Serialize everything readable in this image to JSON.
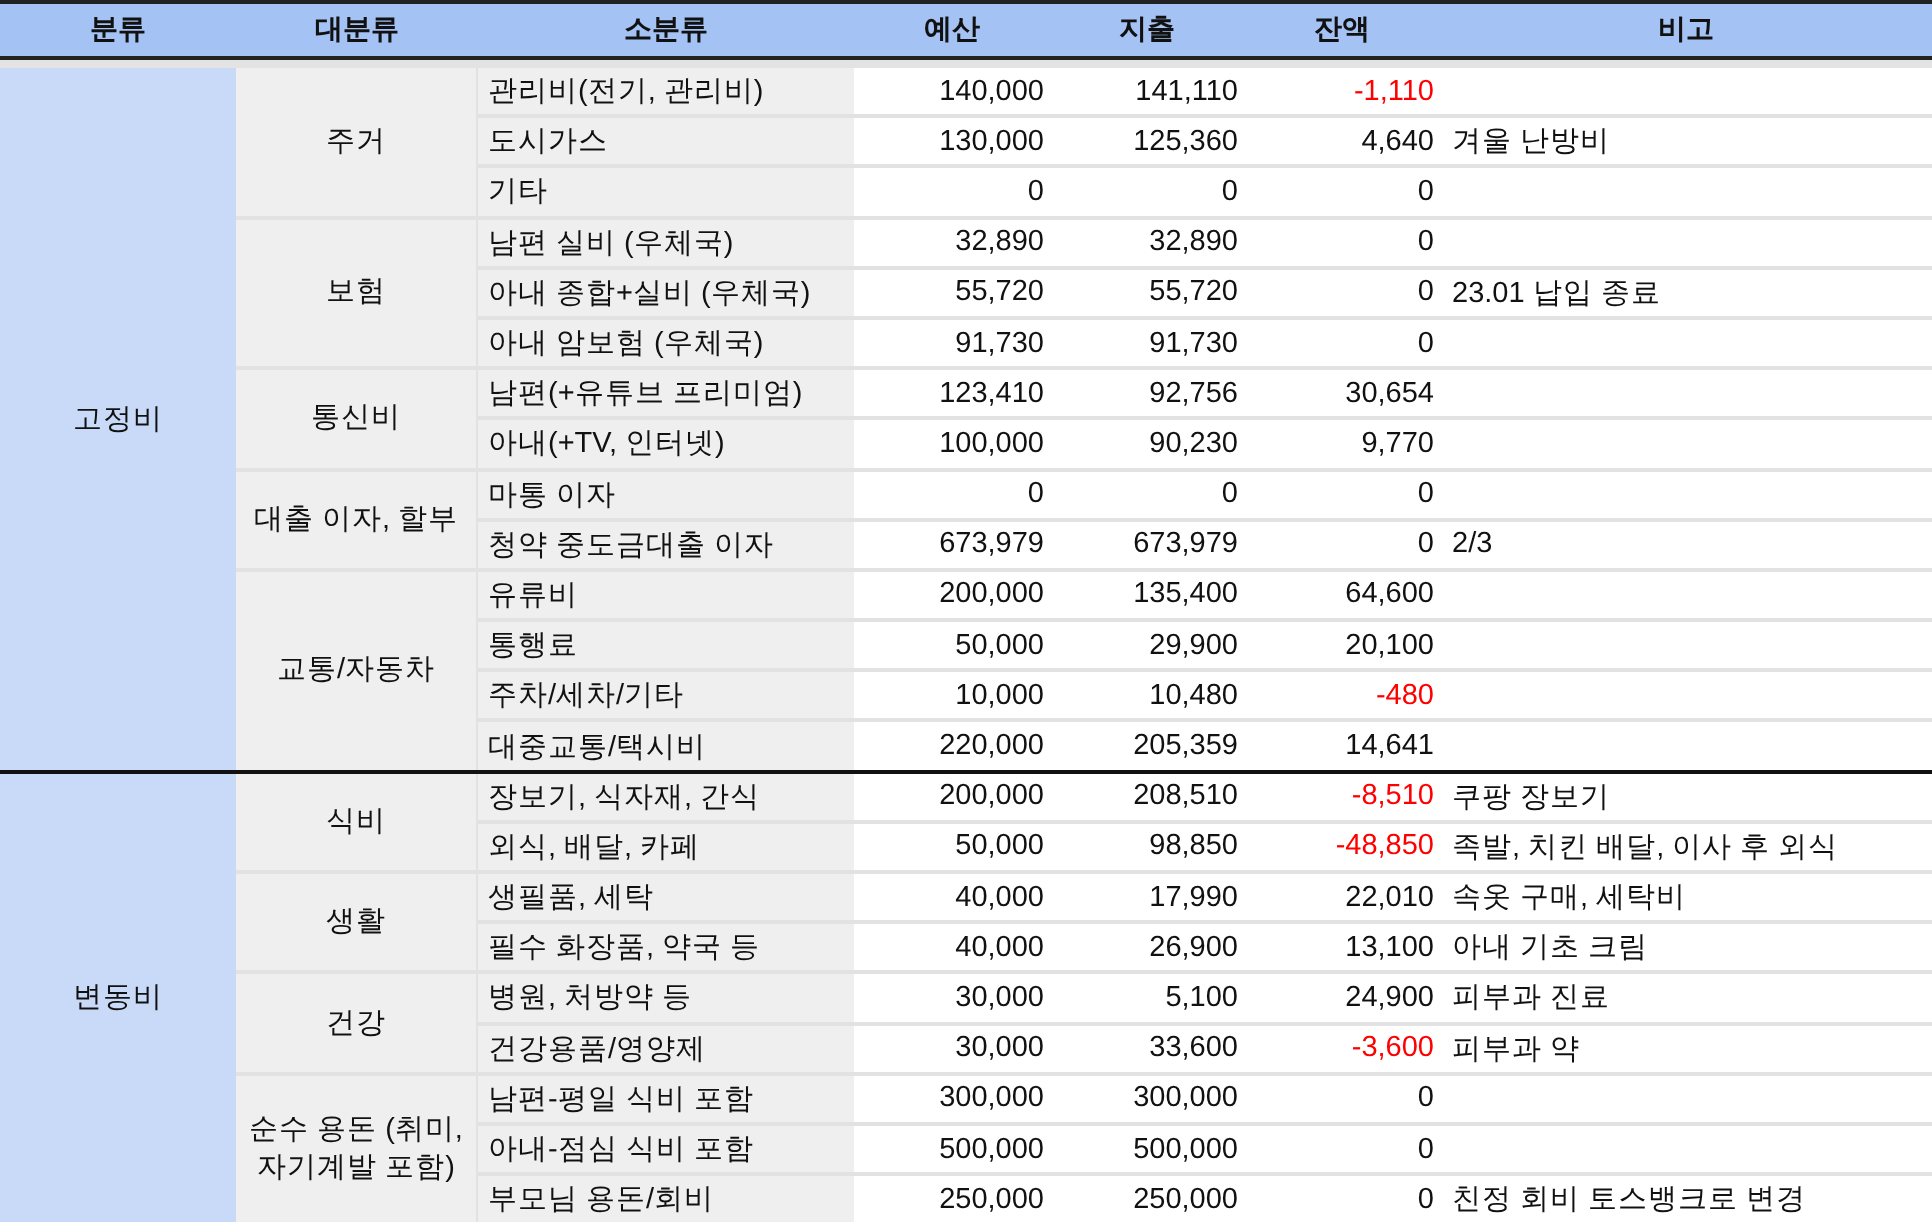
{
  "columns": [
    "분류",
    "대분류",
    "소분류",
    "예산",
    "지출",
    "잔액",
    "비고"
  ],
  "groups": [
    {
      "name": "고정비",
      "categories": [
        {
          "name": "주거",
          "items": [
            {
              "name": "관리비(전기, 관리비)",
              "budget": "140,000",
              "spent": "141,110",
              "balance": "-1,110",
              "over_budget": true
            },
            {
              "name": "도시가스",
              "budget": "130,000",
              "spent": "125,360",
              "balance": "4,640",
              "over_budget": false,
              "note": "겨울 난방비"
            },
            {
              "name": "기타",
              "budget": "0",
              "spent": "0",
              "balance": "0",
              "over_budget": false
            }
          ]
        },
        {
          "name": "보험",
          "items": [
            {
              "name": "남편 실비 (우체국)",
              "budget": "32,890",
              "spent": "32,890",
              "balance": "0",
              "over_budget": false
            },
            {
              "name": "아내 종합+실비 (우체국)",
              "budget": "55,720",
              "spent": "55,720",
              "balance": "0",
              "over_budget": false,
              "note": "23.01 납입 종료"
            },
            {
              "name": "아내 암보험 (우체국)",
              "budget": "91,730",
              "spent": "91,730",
              "balance": "0",
              "over_budget": false
            }
          ]
        },
        {
          "name": "통신비",
          "items": [
            {
              "name": "남편(+유튜브 프리미엄)",
              "budget": "123,410",
              "spent": "92,756",
              "balance": "30,654",
              "over_budget": false
            },
            {
              "name": "아내(+TV, 인터넷)",
              "budget": "100,000",
              "spent": "90,230",
              "balance": "9,770",
              "over_budget": false
            }
          ]
        },
        {
          "name": "대출 이자, 할부",
          "items": [
            {
              "name": "마통 이자",
              "budget": "0",
              "spent": "0",
              "balance": "0",
              "over_budget": false
            },
            {
              "name": "청약 중도금대출 이자",
              "budget": "673,979",
              "spent": "673,979",
              "balance": "0",
              "over_budget": false,
              "note": "2/3"
            }
          ]
        },
        {
          "name": "교통/자동차",
          "items": [
            {
              "name": "유류비",
              "budget": "200,000",
              "spent": "135,400",
              "balance": "64,600",
              "over_budget": false
            },
            {
              "name": "통행료",
              "budget": "50,000",
              "spent": "29,900",
              "balance": "20,100",
              "over_budget": false
            },
            {
              "name": "주차/세차/기타",
              "budget": "10,000",
              "spent": "10,480",
              "balance": "-480",
              "over_budget": true
            },
            {
              "name": "대중교통/택시비",
              "budget": "220,000",
              "spent": "205,359",
              "balance": "14,641",
              "over_budget": false
            }
          ]
        }
      ]
    },
    {
      "name": "변동비",
      "categories": [
        {
          "name": "식비",
          "items": [
            {
              "name": "장보기, 식자재, 간식",
              "budget": "200,000",
              "spent": "208,510",
              "balance": "-8,510",
              "over_budget": true,
              "note": "쿠팡 장보기"
            },
            {
              "name": "외식, 배달, 카페",
              "budget": "50,000",
              "spent": "98,850",
              "balance": "-48,850",
              "over_budget": true,
              "note": "족발, 치킨 배달, 이사 후 외식"
            }
          ]
        },
        {
          "name": "생활",
          "items": [
            {
              "name": "생필품, 세탁",
              "budget": "40,000",
              "spent": "17,990",
              "balance": "22,010",
              "over_budget": false,
              "note": "속옷 구매, 세탁비"
            },
            {
              "name": "필수 화장품, 약국 등",
              "budget": "40,000",
              "spent": "26,900",
              "balance": "13,100",
              "over_budget": false,
              "note": "아내 기초 크림"
            }
          ]
        },
        {
          "name": "건강",
          "items": [
            {
              "name": "병원, 처방약 등",
              "budget": "30,000",
              "spent": "5,100",
              "balance": "24,900",
              "over_budget": false,
              "note": "피부과 진료"
            },
            {
              "name": "건강용품/영양제",
              "budget": "30,000",
              "spent": "33,600",
              "balance": "-3,600",
              "over_budget": true,
              "note": "피부과 약"
            }
          ]
        },
        {
          "name": "순수 용돈 (취미, 자기계발 포함)",
          "items": [
            {
              "name": "남편-평일 식비 포함",
              "budget": "300,000",
              "spent": "300,000",
              "balance": "0",
              "over_budget": false
            },
            {
              "name": "아내-점심 식비 포함",
              "budget": "500,000",
              "spent": "500,000",
              "balance": "0",
              "over_budget": false
            },
            {
              "name": "부모님 용돈/회비",
              "budget": "250,000",
              "spent": "250,000",
              "balance": "0",
              "over_budget": false,
              "note": "친정 회비 토스뱅크로 변경"
            }
          ]
        }
      ]
    }
  ]
}
